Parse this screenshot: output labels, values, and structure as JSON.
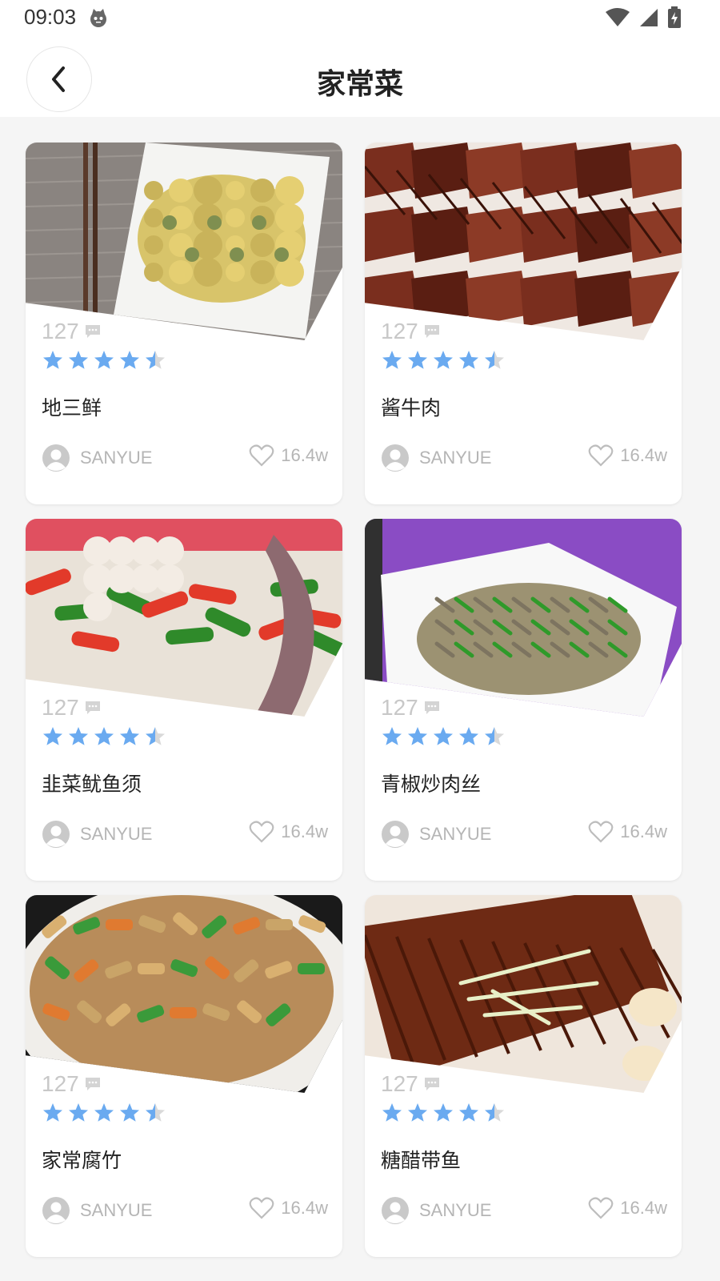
{
  "status": {
    "time": "09:03"
  },
  "header": {
    "title": "家常菜"
  },
  "cards": [
    {
      "name": "地三鲜",
      "comments": "127",
      "rating": 4.5,
      "author": "SANYUE",
      "likes": "16.4w",
      "photo": "potato"
    },
    {
      "name": "酱牛肉",
      "comments": "127",
      "rating": 4.5,
      "author": "SANYUE",
      "likes": "16.4w",
      "photo": "beef"
    },
    {
      "name": "韭菜鱿鱼须",
      "comments": "127",
      "rating": 4.5,
      "author": "SANYUE",
      "likes": "16.4w",
      "photo": "squid"
    },
    {
      "name": "青椒炒肉丝",
      "comments": "127",
      "rating": 4.5,
      "author": "SANYUE",
      "likes": "16.4w",
      "photo": "pepper"
    },
    {
      "name": "家常腐竹",
      "comments": "127",
      "rating": 4.5,
      "author": "SANYUE",
      "likes": "16.4w",
      "photo": "tofu"
    },
    {
      "name": "糖醋带鱼",
      "comments": "127",
      "rating": 4.5,
      "author": "SANYUE",
      "likes": "16.4w",
      "photo": "fish"
    }
  ],
  "colors": {
    "star": "#6aaaf0",
    "star_empty": "#d9d9d9",
    "muted": "#b5b5b5"
  },
  "icons": {
    "back": "chevron-left-icon",
    "comment": "comment-bubble-icon",
    "avatar": "user-avatar-icon",
    "like": "heart-outline-icon"
  }
}
